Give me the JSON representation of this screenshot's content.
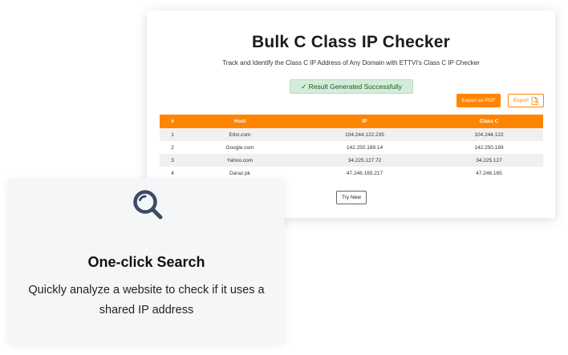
{
  "result_panel": {
    "title": "Bulk C Class IP Checker",
    "subtitle": "Track and Identify the Class C IP Address of Any Domain with ETTVI's Class C IP Checker",
    "success_message": "✓ Result Generated Successfully",
    "export_pdf_label": "Export as PDF",
    "export_label": "Export",
    "try_new_label": "Try New",
    "table": {
      "headers": [
        "#",
        "Host",
        "IP",
        "Class C"
      ],
      "rows": [
        [
          "1",
          "Ettvi.com",
          "104.244.122.235",
          "104.244.122"
        ],
        [
          "2",
          "Google.com",
          "142.250.189.14",
          "142.250.189"
        ],
        [
          "3",
          "Yahoo.com",
          "34.225.127.72",
          "34.225.127"
        ],
        [
          "4",
          "Daraz.pk",
          "47.246.165.217",
          "47.246.165"
        ]
      ]
    }
  },
  "feature": {
    "icon": "search-icon",
    "title": "One-click Search",
    "description": "Quickly analyze a website to check if it uses a shared IP address"
  },
  "colors": {
    "accent": "#ff8400",
    "success_bg": "#d4edda",
    "icon": "#3d4a63"
  }
}
